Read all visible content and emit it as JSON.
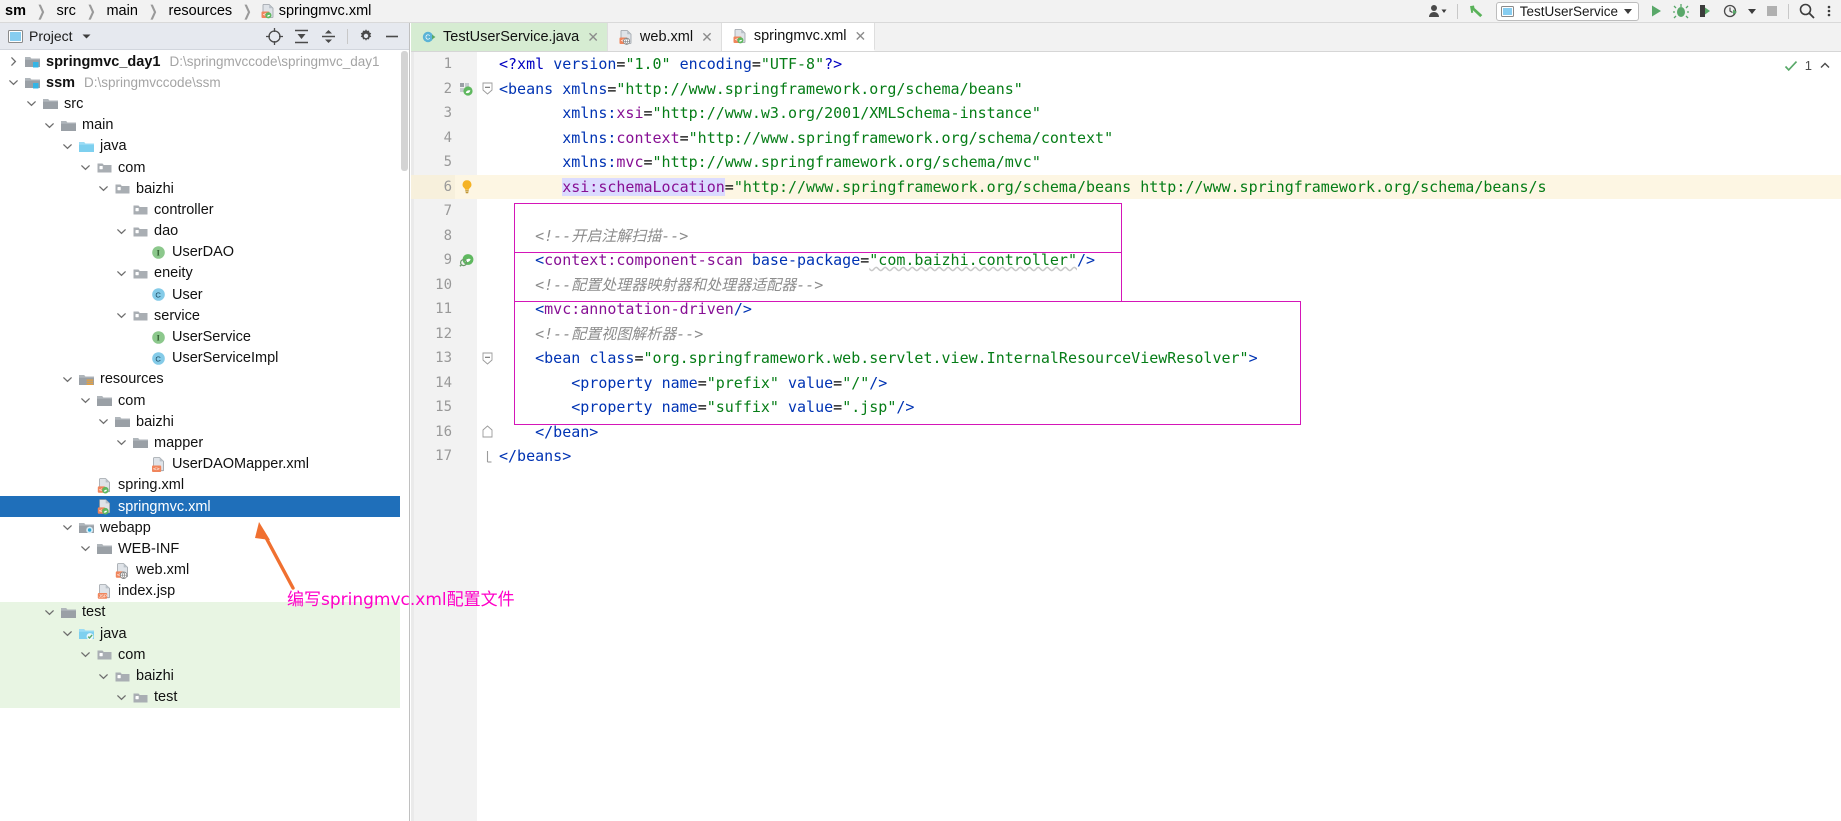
{
  "navbar": {
    "crumbs": [
      {
        "label": "sm",
        "icon": "none",
        "bold": true
      },
      {
        "label": "src",
        "icon": "none",
        "bold": false
      },
      {
        "label": "main",
        "icon": "none",
        "bold": false
      },
      {
        "label": "resources",
        "icon": "none",
        "bold": false
      },
      {
        "label": "springmvc.xml",
        "icon": "xml-spring-file-icon",
        "bold": false
      }
    ],
    "user_icon": "user-avatar-icon",
    "updates_icon": "green-arrow-icon",
    "run_config": "TestUserService",
    "run_icon": "run-icon",
    "debug_icon": "debug-icon",
    "run_coverage_icon": "run-with-coverage-icon",
    "profile_icon": "profiler-icon",
    "stop_icon": "stop-icon",
    "search_icon": "search-icon",
    "more_icon": "more-icon",
    "accent_green": "#4caf50",
    "accent_blue": "#1f6fba"
  },
  "toolwindow": {
    "title": "Project",
    "window_icon": "project-window-icon",
    "dropdown_icon": "chevron-down-icon",
    "actions": [
      {
        "name": "locate-icon",
        "label": "Select Opened File"
      },
      {
        "name": "expand-all-icon",
        "label": "Expand All"
      },
      {
        "name": "collapse-all-icon",
        "label": "Collapse All"
      },
      {
        "name": "gear-icon",
        "label": "Settings"
      },
      {
        "name": "minimize-icon",
        "label": "Hide"
      }
    ]
  },
  "tree": [
    {
      "indent": 0,
      "twist": "right",
      "icon": "module-icon",
      "label": "springmvc_day1",
      "bold": true,
      "path": "D:\\springmvccode\\springmvc_day1",
      "selected": false,
      "green": false
    },
    {
      "indent": 0,
      "twist": "down",
      "icon": "module-icon",
      "label": "ssm",
      "bold": true,
      "path": "D:\\springmvccode\\ssm",
      "selected": false,
      "green": false
    },
    {
      "indent": 1,
      "twist": "down",
      "icon": "folder-gray-icon",
      "label": "src",
      "bold": false,
      "path": "",
      "selected": false,
      "green": false
    },
    {
      "indent": 2,
      "twist": "down",
      "icon": "folder-gray-icon",
      "label": "main",
      "bold": false,
      "path": "",
      "selected": false,
      "green": false
    },
    {
      "indent": 3,
      "twist": "down",
      "icon": "folder-source-icon",
      "label": "java",
      "bold": false,
      "path": "",
      "selected": false,
      "green": false
    },
    {
      "indent": 4,
      "twist": "down",
      "icon": "package-icon",
      "label": "com",
      "bold": false,
      "path": "",
      "selected": false,
      "green": false
    },
    {
      "indent": 5,
      "twist": "down",
      "icon": "package-icon",
      "label": "baizhi",
      "bold": false,
      "path": "",
      "selected": false,
      "green": false
    },
    {
      "indent": 6,
      "twist": "none",
      "icon": "package-icon",
      "label": "controller",
      "bold": false,
      "path": "",
      "selected": false,
      "green": false
    },
    {
      "indent": 6,
      "twist": "down",
      "icon": "package-icon",
      "label": "dao",
      "bold": false,
      "path": "",
      "selected": false,
      "green": false
    },
    {
      "indent": 7,
      "twist": "none",
      "icon": "interface-icon",
      "label": "UserDAO",
      "bold": false,
      "path": "",
      "selected": false,
      "green": false
    },
    {
      "indent": 6,
      "twist": "down",
      "icon": "package-icon",
      "label": "eneity",
      "bold": false,
      "path": "",
      "selected": false,
      "green": false
    },
    {
      "indent": 7,
      "twist": "none",
      "icon": "class-icon",
      "label": "User",
      "bold": false,
      "path": "",
      "selected": false,
      "green": false
    },
    {
      "indent": 6,
      "twist": "down",
      "icon": "package-icon",
      "label": "service",
      "bold": false,
      "path": "",
      "selected": false,
      "green": false
    },
    {
      "indent": 7,
      "twist": "none",
      "icon": "interface-icon",
      "label": "UserService",
      "bold": false,
      "path": "",
      "selected": false,
      "green": false
    },
    {
      "indent": 7,
      "twist": "none",
      "icon": "class-icon",
      "label": "UserServiceImpl",
      "bold": false,
      "path": "",
      "selected": false,
      "green": false
    },
    {
      "indent": 3,
      "twist": "down",
      "icon": "folder-resource-icon",
      "label": "resources",
      "bold": false,
      "path": "",
      "selected": false,
      "green": false
    },
    {
      "indent": 4,
      "twist": "down",
      "icon": "folder-gray-icon",
      "label": "com",
      "bold": false,
      "path": "",
      "selected": false,
      "green": false
    },
    {
      "indent": 5,
      "twist": "down",
      "icon": "folder-gray-icon",
      "label": "baizhi",
      "bold": false,
      "path": "",
      "selected": false,
      "green": false
    },
    {
      "indent": 6,
      "twist": "down",
      "icon": "folder-gray-icon",
      "label": "mapper",
      "bold": false,
      "path": "",
      "selected": false,
      "green": false
    },
    {
      "indent": 7,
      "twist": "none",
      "icon": "xml-code-file-icon",
      "label": "UserDAOMapper.xml",
      "bold": false,
      "path": "",
      "selected": false,
      "green": false
    },
    {
      "indent": 4,
      "twist": "none",
      "icon": "xml-spring-file-icon",
      "label": "spring.xml",
      "bold": false,
      "path": "",
      "selected": false,
      "green": false
    },
    {
      "indent": 4,
      "twist": "none",
      "icon": "xml-spring-file-icon",
      "label": "springmvc.xml",
      "bold": false,
      "path": "",
      "selected": true,
      "green": false
    },
    {
      "indent": 3,
      "twist": "down",
      "icon": "folder-web-icon",
      "label": "webapp",
      "bold": false,
      "path": "",
      "selected": false,
      "green": false
    },
    {
      "indent": 4,
      "twist": "down",
      "icon": "folder-gray-icon",
      "label": "WEB-INF",
      "bold": false,
      "path": "",
      "selected": false,
      "green": false
    },
    {
      "indent": 5,
      "twist": "none",
      "icon": "xml-web-file-icon",
      "label": "web.xml",
      "bold": false,
      "path": "",
      "selected": false,
      "green": false
    },
    {
      "indent": 4,
      "twist": "none",
      "icon": "jsp-file-icon",
      "label": "index.jsp",
      "bold": false,
      "path": "",
      "selected": false,
      "green": false
    },
    {
      "indent": 2,
      "twist": "down",
      "icon": "folder-gray-icon",
      "label": "test",
      "bold": false,
      "path": "",
      "selected": false,
      "green": true
    },
    {
      "indent": 3,
      "twist": "down",
      "icon": "folder-test-icon",
      "label": "java",
      "bold": false,
      "path": "",
      "selected": false,
      "green": true
    },
    {
      "indent": 4,
      "twist": "down",
      "icon": "package-icon",
      "label": "com",
      "bold": false,
      "path": "",
      "selected": false,
      "green": true
    },
    {
      "indent": 5,
      "twist": "down",
      "icon": "package-icon",
      "label": "baizhi",
      "bold": false,
      "path": "",
      "selected": false,
      "green": true
    },
    {
      "indent": 6,
      "twist": "down",
      "icon": "package-icon",
      "label": "test",
      "bold": false,
      "path": "",
      "selected": false,
      "green": true
    }
  ],
  "editor": {
    "tabs": [
      {
        "label": "TestUserService.java",
        "icon": "java-class-icon",
        "active": false,
        "green": true,
        "closable": true
      },
      {
        "label": "web.xml",
        "icon": "xml-web-file-icon",
        "active": false,
        "green": false,
        "closable": true
      },
      {
        "label": "springmvc.xml",
        "icon": "xml-spring-file-icon",
        "active": true,
        "green": false,
        "closable": true
      }
    ],
    "inspection_count": "1",
    "inspection_icon": "inspection-ok-icon",
    "chevron_icon": "chevron-up-icon",
    "lines": [
      {
        "n": "1",
        "mark": "none",
        "fold": "none",
        "highlight": false
      },
      {
        "n": "2",
        "mark": "spring-bean-icon",
        "fold": "collapse",
        "highlight": false
      },
      {
        "n": "3",
        "mark": "none",
        "fold": "none",
        "highlight": false
      },
      {
        "n": "4",
        "mark": "none",
        "fold": "none",
        "highlight": false
      },
      {
        "n": "5",
        "mark": "none",
        "fold": "none",
        "highlight": false
      },
      {
        "n": "6",
        "mark": "lightbulb-icon",
        "fold": "none",
        "highlight": true
      },
      {
        "n": "7",
        "mark": "none",
        "fold": "none",
        "highlight": false
      },
      {
        "n": "8",
        "mark": "none",
        "fold": "none",
        "highlight": false
      },
      {
        "n": "9",
        "mark": "spring-scan-icon",
        "fold": "none",
        "highlight": false
      },
      {
        "n": "10",
        "mark": "none",
        "fold": "none",
        "highlight": false
      },
      {
        "n": "11",
        "mark": "none",
        "fold": "none",
        "highlight": false
      },
      {
        "n": "12",
        "mark": "none",
        "fold": "none",
        "highlight": false
      },
      {
        "n": "13",
        "mark": "none",
        "fold": "collapse",
        "highlight": false
      },
      {
        "n": "14",
        "mark": "none",
        "fold": "none",
        "highlight": false
      },
      {
        "n": "15",
        "mark": "none",
        "fold": "none",
        "highlight": false
      },
      {
        "n": "16",
        "mark": "none",
        "fold": "collapse-end",
        "highlight": false
      },
      {
        "n": "17",
        "mark": "none",
        "fold": "fold-end",
        "highlight": false
      }
    ],
    "code_text": [
      "<?xml version=\"1.0\" encoding=\"UTF-8\"?>",
      "<beans xmlns=\"http://www.springframework.org/schema/beans\"",
      "       xmlns:xsi=\"http://www.w3.org/2001/XMLSchema-instance\"",
      "       xmlns:context=\"http://www.springframework.org/schema/context\"",
      "       xmlns:mvc=\"http://www.springframework.org/schema/mvc\"",
      "       xsi:schemaLocation=\"http://www.springframework.org/schema/beans http://www.springframework.org/schema/beans/s",
      "",
      "    <!--开启注解扫描-->",
      "    <context:component-scan base-package=\"com.baizhi.controller\"/>",
      "    <!--配置处理器映射器和处理器适配器-->",
      "    <mvc:annotation-driven/>",
      "    <!--配置视图解析器-->",
      "    <bean class=\"org.springframework.web.servlet.view.InternalResourceViewResolver\">",
      "        <property name=\"prefix\" value=\"/\"/>",
      "        <property name=\"suffix\" value=\".jsp\"/>",
      "    </bean>",
      "</beans>"
    ]
  },
  "annotation": {
    "text": "编写springmvc.xml配置文件",
    "color": "#ff00c8",
    "arrow_color": "#f07030",
    "highlight_boxes": 3
  }
}
